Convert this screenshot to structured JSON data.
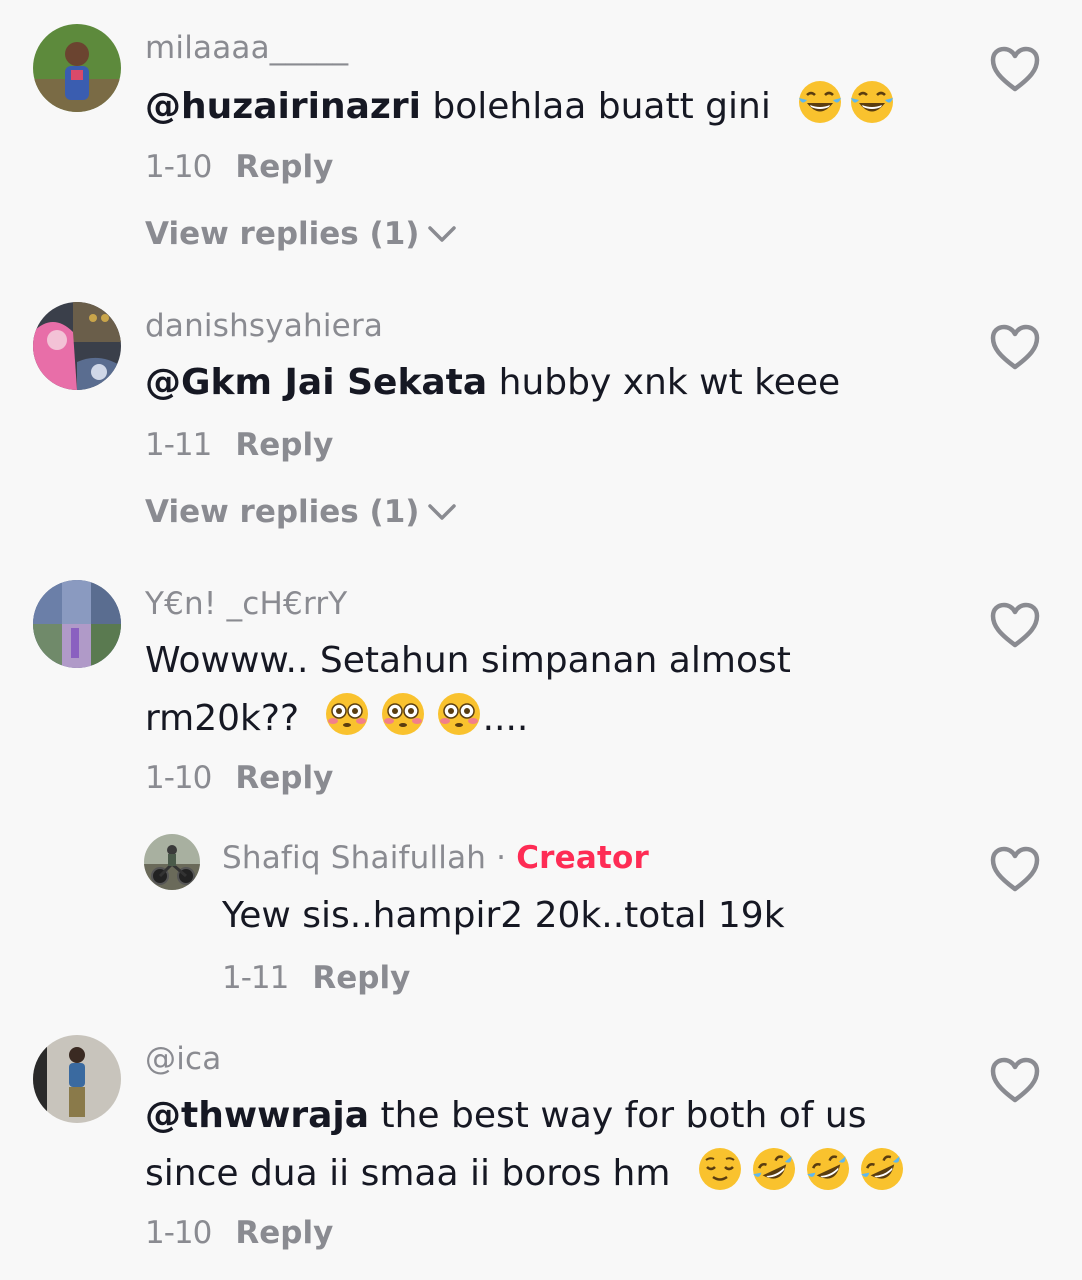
{
  "comments": [
    {
      "username": "milaaaa_____",
      "mention": "@huzairinazri",
      "text": " bolehlaa buatt gini",
      "emoji": [
        "face-with-tears-of-joy",
        "face-with-tears-of-joy"
      ],
      "date": "1-10",
      "reply_label": "Reply",
      "view_replies": "View replies (1)"
    },
    {
      "username": "danishsyahiera",
      "mention": "@Gkm Jai Sekata",
      "text": " hubby xnk wt keee",
      "date": "1-11",
      "reply_label": "Reply",
      "view_replies": "View replies (1)"
    },
    {
      "username": "Y€n! _cH€rrY",
      "text_line1": "Wowww.. Setahun simpanan almost",
      "text_line2": "rm20k??",
      "emoji": [
        "flushed-face",
        "flushed-face",
        "flushed-face"
      ],
      "text_line2_suffix": "....",
      "date": "1-10",
      "reply_label": "Reply",
      "reply": {
        "username": "Shafiq Shaifullah",
        "separator": "·",
        "badge": "Creator",
        "text": "Yew sis..hampir2 20k..total 19k",
        "date": "1-11",
        "reply_label": "Reply"
      }
    },
    {
      "username": "@ica",
      "mention": "@thwwraja",
      "text": " the best way for both of us",
      "text_line2": "since dua ii smaa ii boros hm",
      "emoji": [
        "relieved-face",
        "rolling-on-floor-laughing",
        "rolling-on-floor-laughing",
        "rolling-on-floor-laughing"
      ],
      "date": "1-10",
      "reply_label": "Reply"
    }
  ],
  "colors": {
    "background": "#f8f8f8",
    "text": "#161823",
    "muted": "#8a8b91",
    "creator": "#fe2c55"
  }
}
